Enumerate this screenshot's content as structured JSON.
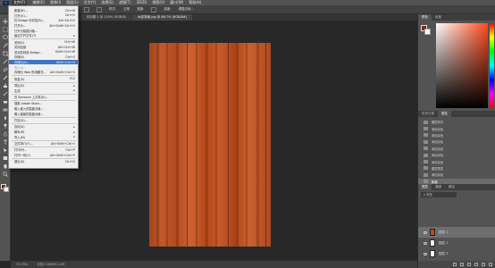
{
  "menubar": {
    "logo": "Ps",
    "items": [
      "文件(F)",
      "编辑(E)",
      "图像(I)",
      "图层(L)",
      "文字(Y)",
      "选择(S)",
      "滤镜(T)",
      "3D(D)",
      "视图(V)",
      "窗口(W)",
      "帮助(H)"
    ]
  },
  "doc_tabs": [
    "新建文档.psd @ 66.7% (图层 1, RGB/8)",
    "未标题-1 @ 100% (RGB/8)",
    "木纹背景.jpg @ 66.7% (RGB/8#)"
  ],
  "options": [
    "样式:",
    "正常",
    "宽度:",
    "高度:",
    "调整边缘..."
  ],
  "file_menu": [
    {
      "label": "新建(N)...",
      "shortcut": "Ctrl+N"
    },
    {
      "label": "打开(O)...",
      "shortcut": "Ctrl+O"
    },
    {
      "label": "在 Bridge 中浏览(B)...",
      "shortcut": "Alt+Ctrl+O"
    },
    {
      "label": "打开为...",
      "shortcut": "Alt+Shift+Ctrl+O"
    },
    {
      "label": "打开为智能对象...",
      "shortcut": ""
    },
    {
      "label": "最近打开文件(T)",
      "shortcut": "▸"
    },
    {
      "label": "关闭(C)",
      "shortcut": "Ctrl+W"
    },
    {
      "label": "关闭全部",
      "shortcut": "Alt+Ctrl+W"
    },
    {
      "label": "关闭并转到 Bridge...",
      "shortcut": "Shift+Ctrl+W"
    },
    {
      "label": "存储(S)",
      "shortcut": "Ctrl+S"
    },
    {
      "label": "存储为(A)...",
      "shortcut": "Shift+Ctrl+S"
    },
    {
      "label": "签入(I)...",
      "shortcut": ""
    },
    {
      "label": "存储为 Web 所用格式...",
      "shortcut": "Alt+Shift+Ctrl+S"
    },
    {
      "label": "恢复(V)",
      "shortcut": "F12"
    },
    {
      "label": "导出(E)",
      "shortcut": "▸"
    },
    {
      "label": "生成",
      "shortcut": "▸"
    },
    {
      "label": "在 Behance 上共享(D)...",
      "shortcut": ""
    },
    {
      "label": "搜索 Adobe Stock...",
      "shortcut": ""
    },
    {
      "label": "置入嵌入的智能对象...",
      "shortcut": ""
    },
    {
      "label": "置入链接的智能对象...",
      "shortcut": ""
    },
    {
      "label": "打包(G)...",
      "shortcut": ""
    },
    {
      "label": "自动(U)",
      "shortcut": "▸"
    },
    {
      "label": "脚本(R)",
      "shortcut": "▸"
    },
    {
      "label": "导入(M)",
      "shortcut": "▸"
    },
    {
      "label": "文件简介(F)...",
      "shortcut": "Alt+Shift+Ctrl+I"
    },
    {
      "label": "打印(P)...",
      "shortcut": "Ctrl+P"
    },
    {
      "label": "打印一份(Y)",
      "shortcut": "Alt+Shift+Ctrl+P"
    },
    {
      "label": "退出(X)",
      "shortcut": "Ctrl+Q"
    }
  ],
  "file_menu_highlight_index": 10,
  "panels": {
    "color_tabs": [
      "颜色",
      "色板"
    ],
    "history_tabs": [
      "历史记录",
      "属性"
    ],
    "history_items": [
      "图层样式",
      "添加杂色",
      "添加杂色",
      "添加杂色",
      "添加杂色",
      "添加杂色",
      "添加杂色",
      "图层属性",
      "添加杂色",
      "新建"
    ],
    "layers_tabs": [
      "图层",
      "通道",
      "路径"
    ],
    "layer_filter": "ρ 类型",
    "layers": [
      "图层 1",
      "图层 2",
      "图层 3"
    ]
  },
  "status": {
    "zoom": "33.33%",
    "doc": "文档:3.85M/11.5M"
  },
  "colors": {
    "foreground": "#7a2b18",
    "background": "#ffffff",
    "accent": "#3876c6"
  }
}
